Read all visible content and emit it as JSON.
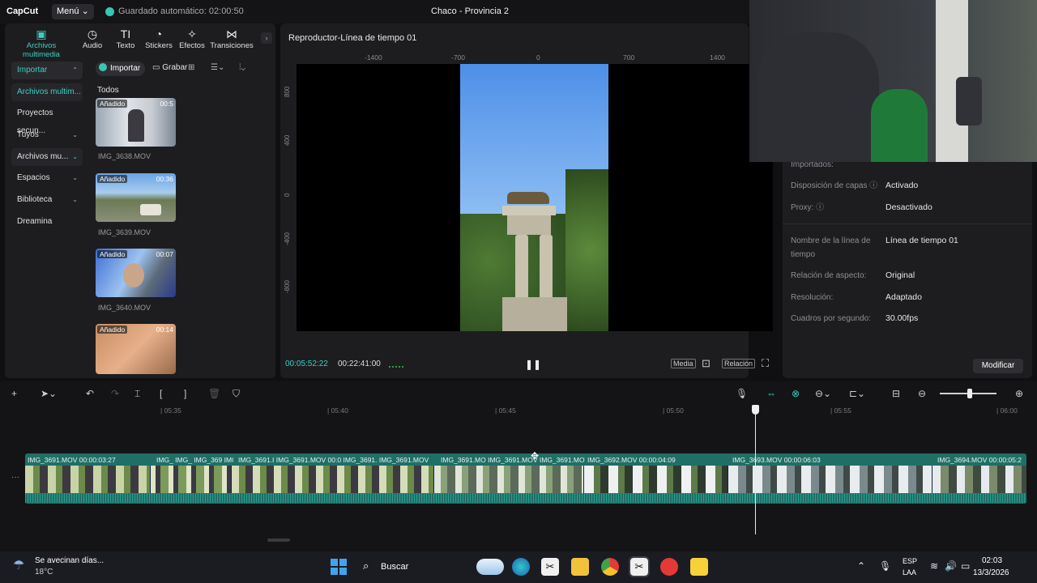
{
  "app": {
    "logo": "CapCut",
    "menu": "Menú ⌄",
    "autosave": "Guardado automático: 02:00:50",
    "project_title": "Chaco - Provincia 2"
  },
  "top_tabs": [
    {
      "label": "Archivos multimedia",
      "icon": "▣"
    },
    {
      "label": "Audio",
      "icon": "◷"
    },
    {
      "label": "Texto",
      "icon": "TI"
    },
    {
      "label": "Stickers",
      "icon": "◔"
    },
    {
      "label": "Efectos",
      "icon": "✧"
    },
    {
      "label": "Transiciones",
      "icon": "⋈"
    }
  ],
  "sidebar": [
    {
      "label": "Importar",
      "chev": "⌃"
    },
    {
      "label": "Archivos multim..."
    },
    {
      "label": "Proyectos secun..."
    },
    {
      "label": "Tuyos",
      "chev": "⌄"
    },
    {
      "label": "Archivos mu...",
      "chev": "⌄"
    },
    {
      "label": "Espacios",
      "chev": "⌄"
    },
    {
      "label": "Biblioteca",
      "chev": "⌄"
    },
    {
      "label": "Dreamina"
    }
  ],
  "media": {
    "import_btn": "Importar",
    "record_btn": "Grabar",
    "all_label": "Todos",
    "items": [
      {
        "name": "IMG_3638.MOV",
        "badge": "Añadido",
        "duration": "00:5"
      },
      {
        "name": "IMG_3639.MOV",
        "badge": "Añadido",
        "duration": "00:36"
      },
      {
        "name": "IMG_3640.MOV",
        "badge": "Añadido",
        "duration": "00:07"
      },
      {
        "name": "",
        "badge": "Añadido",
        "duration": "00:14"
      }
    ]
  },
  "player": {
    "title": "Reproductor-Línea de tiempo 01",
    "ruler_h": [
      "-1400",
      "-700",
      "0",
      "700",
      "1400"
    ],
    "ruler_v": [
      "800",
      "400",
      "0",
      "-400",
      "-800"
    ],
    "time_current": "00:05:52:22",
    "time_total": "00:22:41:00",
    "media_btn": "Media",
    "relation_btn": "Relación"
  },
  "details": {
    "imported_label": "Importados:",
    "rows": [
      {
        "key": "Disposición de capas ⓘ",
        "value": "Activado"
      },
      {
        "key": "Proxy: ⓘ",
        "value": "Desactivado"
      },
      {
        "key": "Nombre de la línea de tiempo",
        "value": "Línea de tiempo 01"
      },
      {
        "key": "Relación de aspecto:",
        "value": "Original"
      },
      {
        "key": "Resolución:",
        "value": "Adaptado"
      },
      {
        "key": "Cuadros por segundo:",
        "value": "30.00fps"
      }
    ],
    "modify_btn": "Modificar"
  },
  "timeline": {
    "ticks": [
      "| 05:35",
      "| 05:40",
      "| 05:45",
      "| 05:50",
      "| 05:55",
      "| 06:00"
    ],
    "clips": [
      {
        "label": "IMG_3691.MOV  00:00:03:27"
      },
      {
        "label": "IMG_ IMG_ IMG_369 IMG"
      },
      {
        "label": "IMG_3691.I  IMG_3691.MOV  00:0  IMG_3691.  IMG_3691.MOV"
      },
      {
        "label": "IMG_3691.MO  IMG_3691.MOV  IMG_3691.MOV"
      },
      {
        "label": "IMG_3692.MOV  00:00:04:09"
      },
      {
        "label": "IMG_3693.MOV  00:00:06:03"
      },
      {
        "label": "IMG_3694.MOV  00:00:05:2"
      }
    ]
  },
  "taskbar": {
    "weather_title": "Se avecinan días...",
    "weather_temp": "18°C",
    "search": "Buscar",
    "lang1": "ESP",
    "lang2": "LAA",
    "time": "02:03",
    "date": "13/3/2026"
  },
  "colors": {
    "accent": "#3ad0c0",
    "track": "#1f6f67"
  }
}
